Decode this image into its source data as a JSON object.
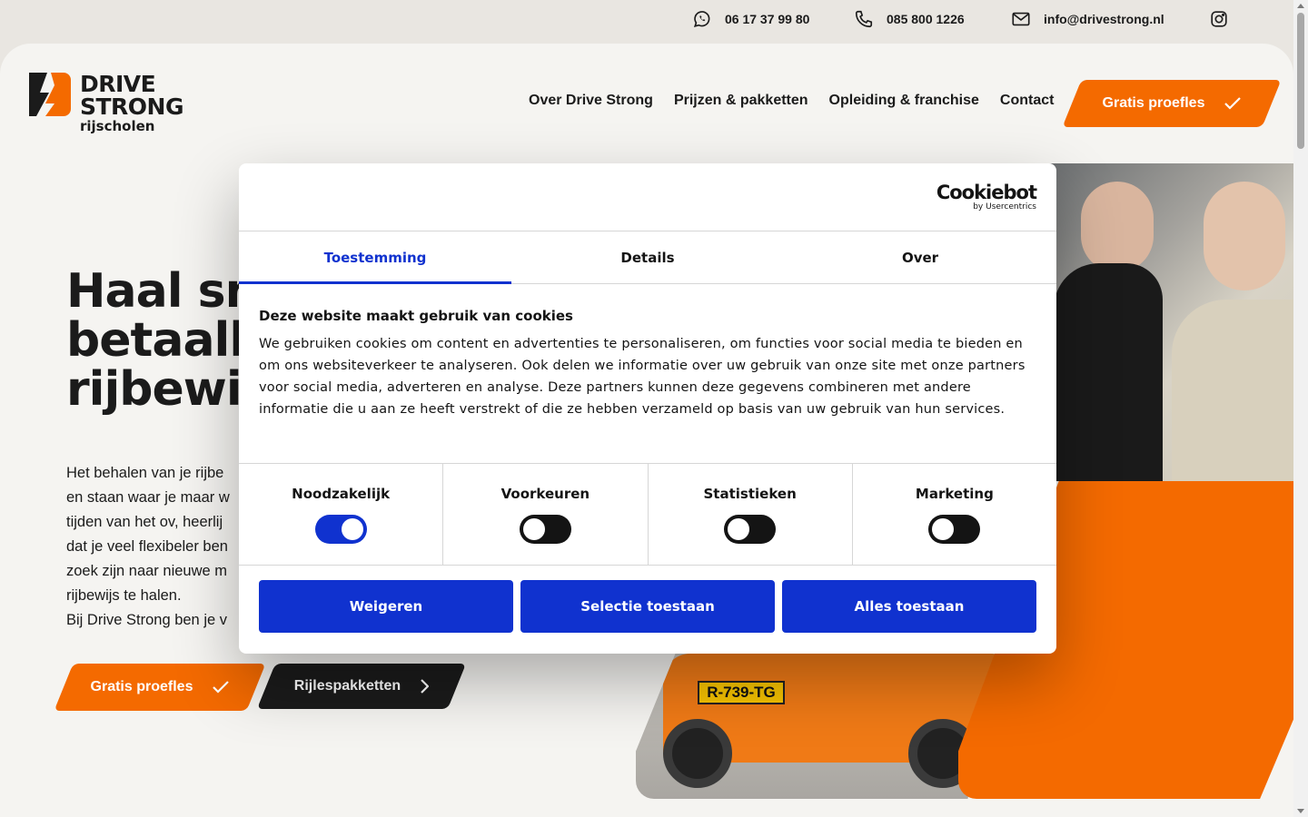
{
  "topbar": {
    "whatsapp": "06 17 37 99 80",
    "phone": "085 800 1226",
    "email": "info@drivestrong.nl"
  },
  "logo": {
    "line1": "DRIVE",
    "line2": "STRONG",
    "line3": "rijscholen"
  },
  "nav": {
    "items": [
      "Over Drive Strong",
      "Prijzen & pakketten",
      "Opleiding & franchise",
      "Contact"
    ],
    "cta": "Gratis proefles"
  },
  "hero": {
    "title_lines": [
      "Haal snel",
      "betaalbaar",
      "rijbewijs"
    ],
    "text_lines": [
      "Het behalen van je rijbe",
      "en staan waar je maar w",
      "tijden van het ov, heerlij",
      "dat je veel flexibeler ben",
      "zoek zijn naar nieuwe m",
      "rijbewijs te halen.",
      "Bij Drive Strong ben je v"
    ],
    "btn_proefles": "Gratis proefles",
    "btn_pakketten": "Rijlespakketten",
    "plate": "R-739-TG"
  },
  "colors": {
    "orange": "#f46a00",
    "cookie_blue": "#1032cf",
    "dark": "#1b1b1b"
  },
  "cookie": {
    "brand": "Cookiebot",
    "brand_sub": "by Usercentrics",
    "tabs": [
      "Toestemming",
      "Details",
      "Over"
    ],
    "active_tab": "Toestemming",
    "heading": "Deze website maakt gebruik van cookies",
    "text": "We gebruiken cookies om content en advertenties te personaliseren, om functies voor social media te bieden en om ons websiteverkeer te analyseren. Ook delen we informatie over uw gebruik van onze site met onze partners voor social media, adverteren en analyse. Deze partners kunnen deze gegevens combineren met andere informatie die u aan ze heeft verstrekt of die ze hebben verzameld op basis van uw gebruik van hun services.",
    "toggles": [
      {
        "label": "Noodzakelijk",
        "on": true
      },
      {
        "label": "Voorkeuren",
        "on": false
      },
      {
        "label": "Statistieken",
        "on": false
      },
      {
        "label": "Marketing",
        "on": false
      }
    ],
    "buttons": [
      "Weigeren",
      "Selectie toestaan",
      "Alles toestaan"
    ]
  },
  "icons": [
    "whatsapp-icon",
    "phone-icon",
    "mail-icon",
    "instagram-icon",
    "checkmark-icon",
    "chevron-right-icon"
  ]
}
